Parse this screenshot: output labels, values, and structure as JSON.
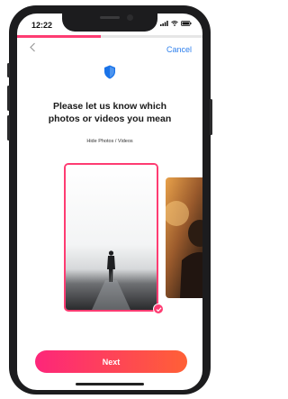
{
  "status_bar": {
    "time": "12:22"
  },
  "onboarding": {
    "progress": 0.45
  },
  "header": {
    "back_icon": "chevron-left-icon",
    "cancel_label": "Cancel"
  },
  "content": {
    "shield_icon": "shield-icon",
    "title_line1": "Please let us know which",
    "title_line2": "photos or videos you mean",
    "subtitle": "Hide Photos / Videos"
  },
  "footer": {
    "next_label": "Next"
  },
  "colors": {
    "accent": "#fe3c72",
    "link": "#2f80ed",
    "shield": "#1a73e8"
  }
}
